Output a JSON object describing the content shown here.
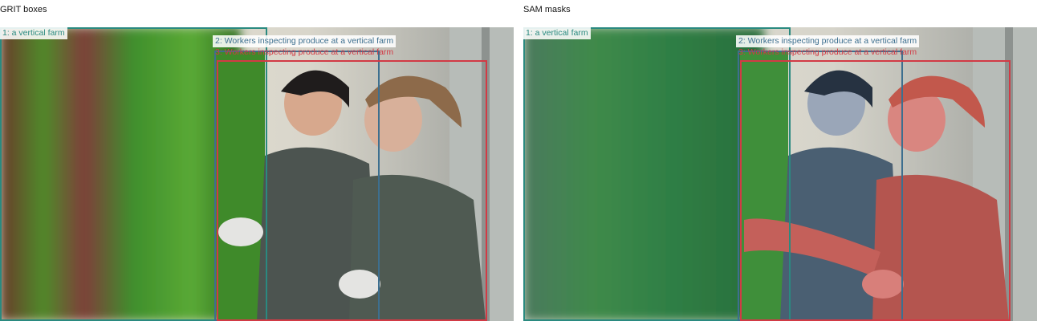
{
  "panels": [
    {
      "title": "GRIT boxes",
      "labels": {
        "box1": "1: a vertical farm",
        "box2": "2: Workers inspecting produce at a vertical farm",
        "box3": "3: Workers inspecting produce at a vertical farm"
      }
    },
    {
      "title": "SAM masks",
      "labels": {
        "box1": "1: a vertical farm",
        "box2": "2: Workers inspecting produce at a vertical farm",
        "box3": "3: Workers inspecting produce at a vertical farm"
      }
    }
  ],
  "colors": {
    "box1": "#2a8a80",
    "box2": "#3d6f8f",
    "box3": "#d23a45"
  }
}
